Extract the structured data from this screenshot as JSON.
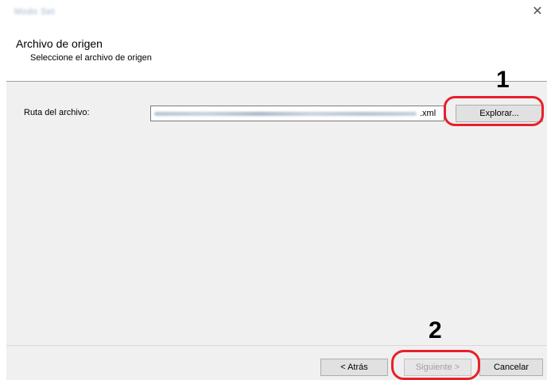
{
  "window": {
    "title": "Modo Set",
    "close_icon": "close-icon"
  },
  "header": {
    "title": "Archivo de origen",
    "subtitle": "Seleccione el archivo de origen"
  },
  "main": {
    "path_label": "Ruta del archivo:",
    "path_value_visible_suffix": ".xml",
    "browse_label": "Explorar..."
  },
  "footer": {
    "back_label": "< Atrás",
    "next_label": "Siguiente >",
    "cancel_label": "Cancelar"
  },
  "annotations": {
    "step_1": "1",
    "step_2": "2",
    "highlight_color": "#e8202a"
  }
}
